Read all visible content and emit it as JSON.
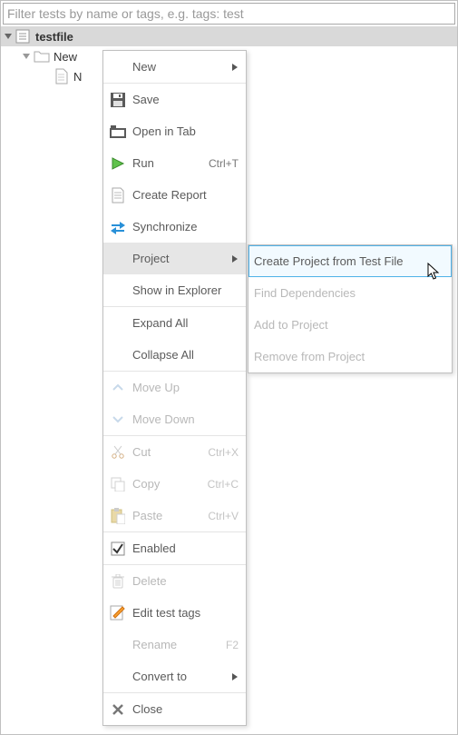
{
  "filter": {
    "placeholder": "Filter tests by name or tags, e.g. tags: test",
    "value": ""
  },
  "tree": {
    "root_label": "testfile",
    "child_label": "New",
    "grandchild_label": "N"
  },
  "menu": {
    "new": "New",
    "save": "Save",
    "open_in_tab": "Open in Tab",
    "run": "Run",
    "run_shortcut": "Ctrl+T",
    "create_report": "Create Report",
    "synchronize": "Synchronize",
    "project": "Project",
    "show_in_explorer": "Show in Explorer",
    "expand_all": "Expand All",
    "collapse_all": "Collapse All",
    "move_up": "Move Up",
    "move_down": "Move Down",
    "cut": "Cut",
    "cut_shortcut": "Ctrl+X",
    "copy": "Copy",
    "copy_shortcut": "Ctrl+C",
    "paste": "Paste",
    "paste_shortcut": "Ctrl+V",
    "enabled": "Enabled",
    "delete": "Delete",
    "edit_tags": "Edit test tags",
    "rename": "Rename",
    "rename_shortcut": "F2",
    "convert_to": "Convert to",
    "close": "Close"
  },
  "submenu": {
    "create_project": "Create Project from Test File",
    "find_deps": "Find Dependencies",
    "add_to_project": "Add to Project",
    "remove_from_project": "Remove from Project"
  }
}
